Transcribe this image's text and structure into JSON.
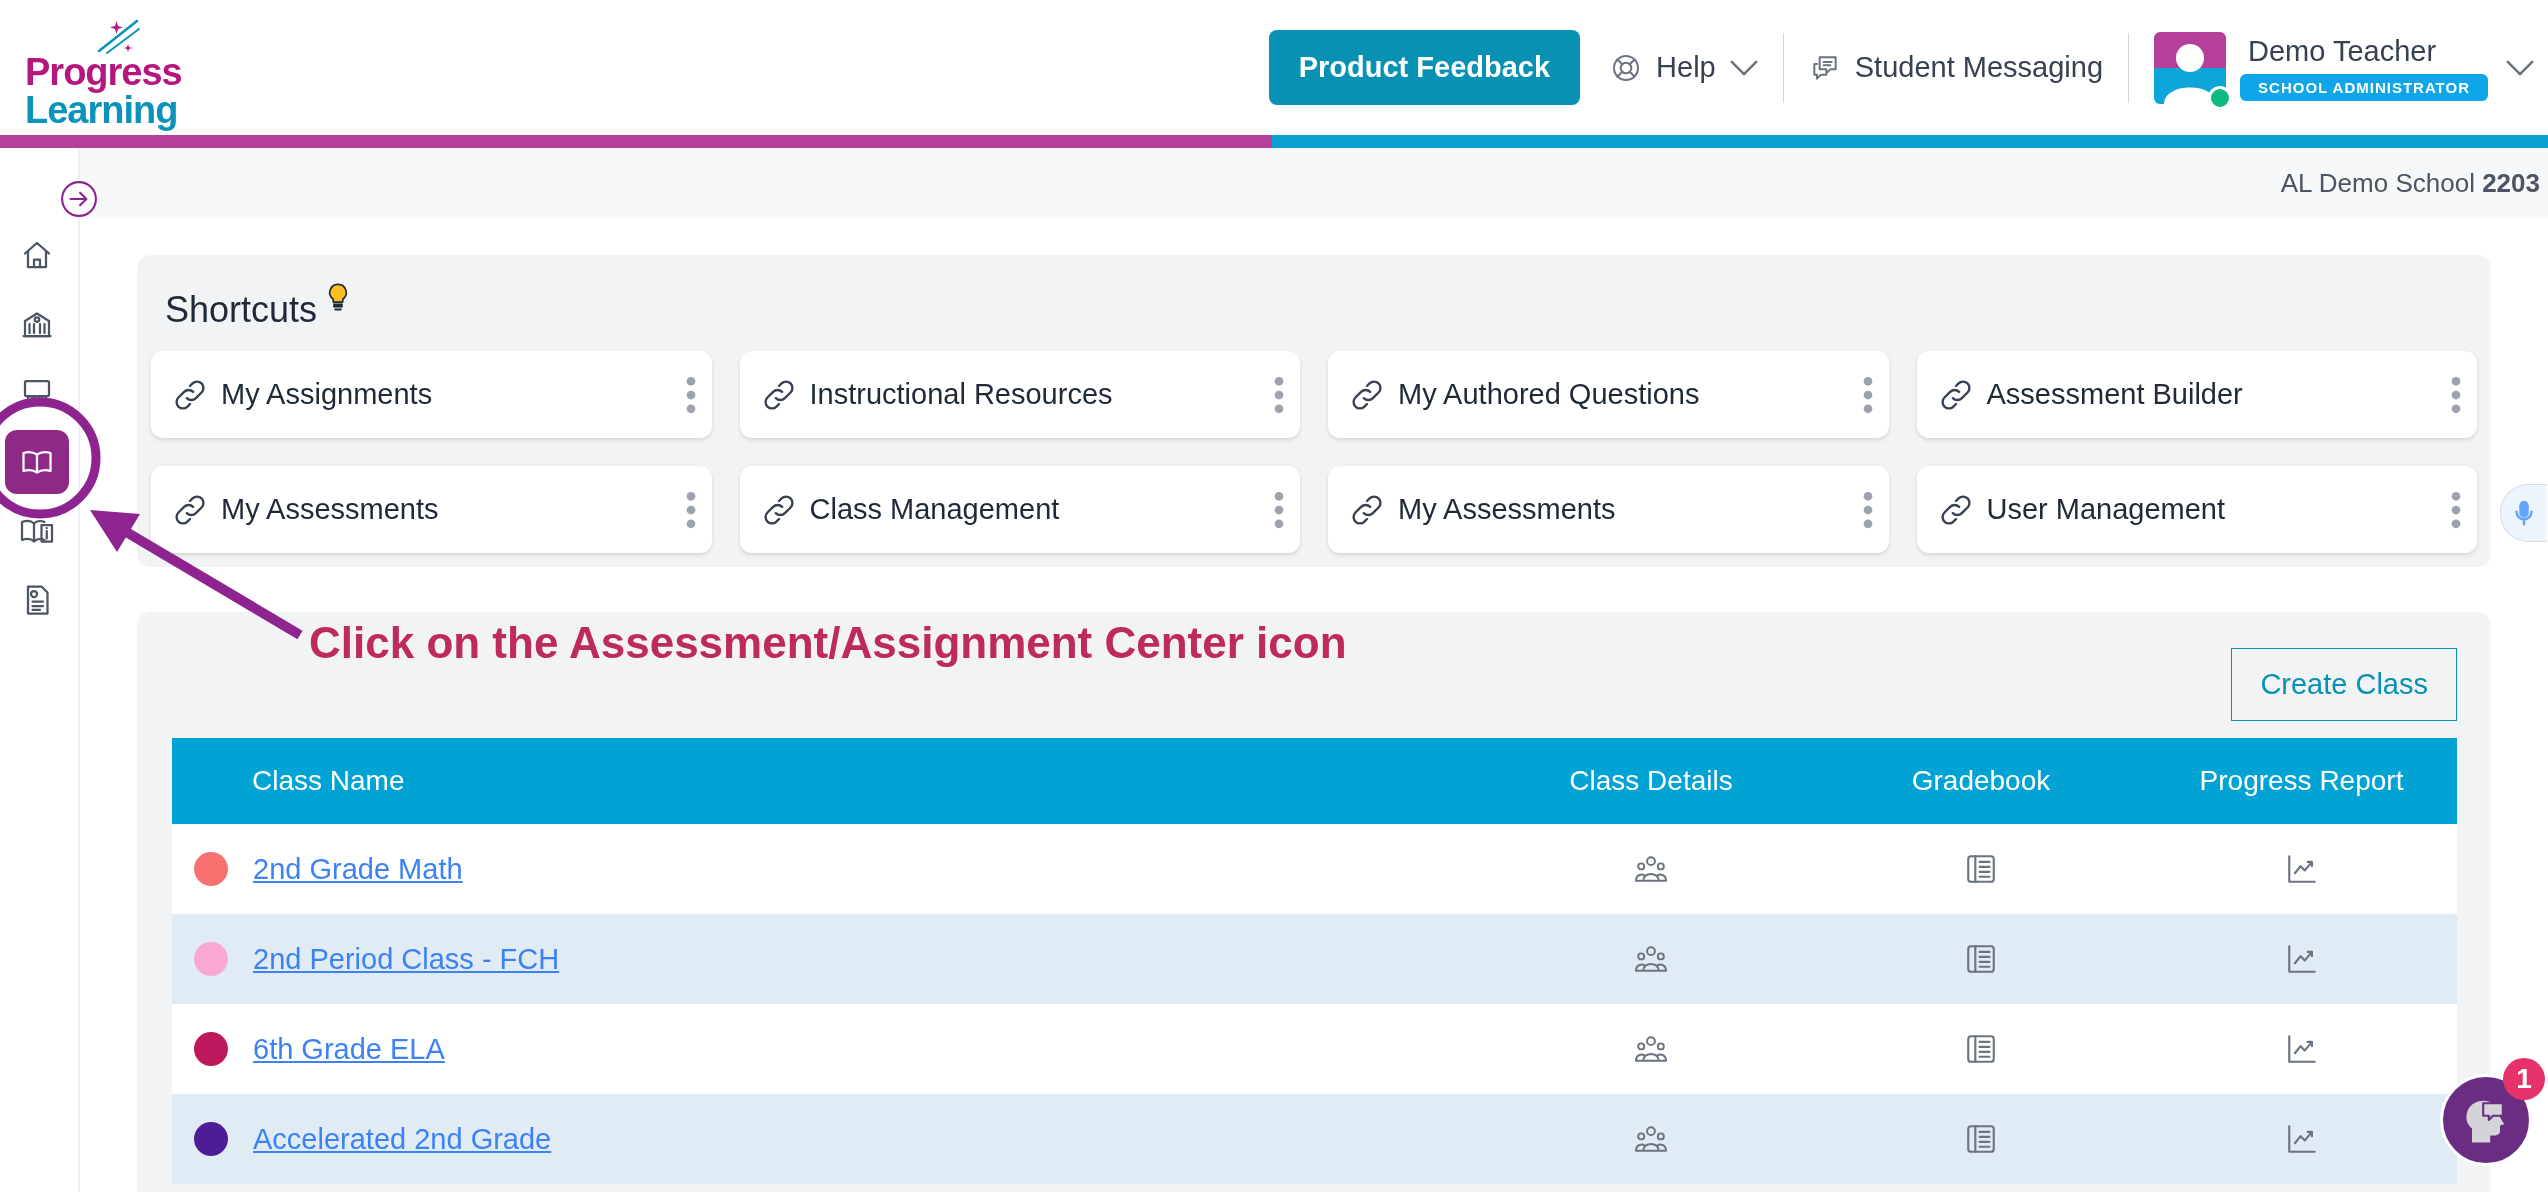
{
  "header": {
    "logo": {
      "line_1": "Progress",
      "line_2": "Learning"
    },
    "feedback_button": "Product Feedback",
    "help": "Help",
    "messaging": "Student Messaging",
    "user": {
      "name": "Demo Teacher",
      "role": "SCHOOL ADMINISTRATOR",
      "online": true
    }
  },
  "school": {
    "name": "AL Demo School",
    "code": "2203"
  },
  "sidebar": {
    "items": [
      {
        "kind": "home",
        "selected": false
      },
      {
        "kind": "school",
        "selected": false
      },
      {
        "kind": "classroom",
        "selected": false
      },
      {
        "kind": "book",
        "selected": true
      },
      {
        "kind": "book-info",
        "selected": false
      },
      {
        "kind": "report",
        "selected": false
      }
    ]
  },
  "shortcuts": {
    "title": "Shortcuts",
    "items": [
      "My Assignments",
      "Instructional Resources",
      "My Authored Questions",
      "Assessment Builder",
      "My Assessments",
      "Class Management",
      "My Assessments",
      "User Management"
    ]
  },
  "classes": {
    "create_button": "Create Class",
    "columns": [
      "Class Name",
      "Class Details",
      "Gradebook",
      "Progress Report"
    ],
    "rows": [
      {
        "name": "2nd Grade Math",
        "color": "#f87171"
      },
      {
        "name": "2nd Period Class - FCH",
        "color": "#f9a8d4"
      },
      {
        "name": "6th Grade ELA",
        "color": "#be185d"
      },
      {
        "name": "Accelerated 2nd Grade",
        "color": "#4c1d95"
      }
    ]
  },
  "annotation": {
    "text": "Click on the Assessment/Assignment Center icon"
  },
  "chat": {
    "badge": "1"
  }
}
